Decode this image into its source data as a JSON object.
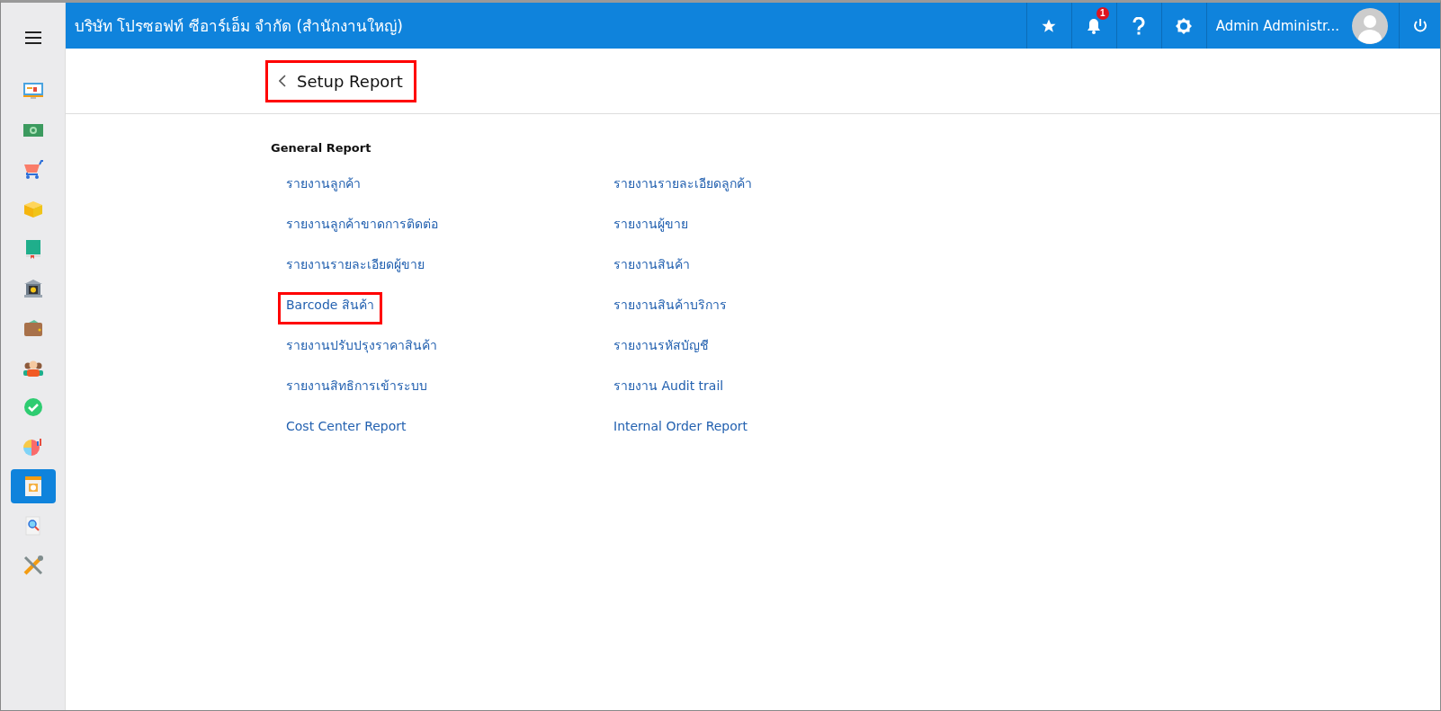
{
  "header": {
    "company": "บริษัท โปรซอฟท์ ซีอาร์เอ็ม จำกัด (สำนักงานใหญ่)",
    "notification_count": "1",
    "user_name": "Admin Administr..."
  },
  "sidebar": {
    "items": [
      {
        "kind": "monitor",
        "selected": false
      },
      {
        "kind": "money",
        "selected": false
      },
      {
        "kind": "cart",
        "selected": false
      },
      {
        "kind": "box",
        "selected": false
      },
      {
        "kind": "book",
        "selected": false
      },
      {
        "kind": "bank",
        "selected": false
      },
      {
        "kind": "wallet",
        "selected": false
      },
      {
        "kind": "people",
        "selected": false
      },
      {
        "kind": "check",
        "selected": false
      },
      {
        "kind": "chart",
        "selected": false
      },
      {
        "kind": "report",
        "selected": true
      },
      {
        "kind": "search",
        "selected": false
      },
      {
        "kind": "tools",
        "selected": false
      }
    ]
  },
  "page": {
    "title": "Setup Report",
    "title_highlighted": true
  },
  "section": {
    "heading": "General Report",
    "links": [
      {
        "label": "รายงานลูกค้า",
        "highlighted": false
      },
      {
        "label": "รายงานรายละเอียดลูกค้า",
        "highlighted": false
      },
      {
        "label": "รายงานลูกค้าขาดการติดต่อ",
        "highlighted": false
      },
      {
        "label": "รายงานผู้ขาย",
        "highlighted": false
      },
      {
        "label": "รายงานรายละเอียดผู้ขาย",
        "highlighted": false
      },
      {
        "label": "รายงานสินค้า",
        "highlighted": false
      },
      {
        "label": "Barcode สินค้า",
        "highlighted": true
      },
      {
        "label": "รายงานสินค้าบริการ",
        "highlighted": false
      },
      {
        "label": "รายงานปรับปรุงราคาสินค้า",
        "highlighted": false
      },
      {
        "label": "รายงานรหัสบัญชี",
        "highlighted": false
      },
      {
        "label": "รายงานสิทธิการเข้าระบบ",
        "highlighted": false
      },
      {
        "label": "รายงาน Audit trail",
        "highlighted": false
      },
      {
        "label": "Cost Center Report",
        "highlighted": false
      },
      {
        "label": "Internal Order Report",
        "highlighted": false
      }
    ]
  }
}
